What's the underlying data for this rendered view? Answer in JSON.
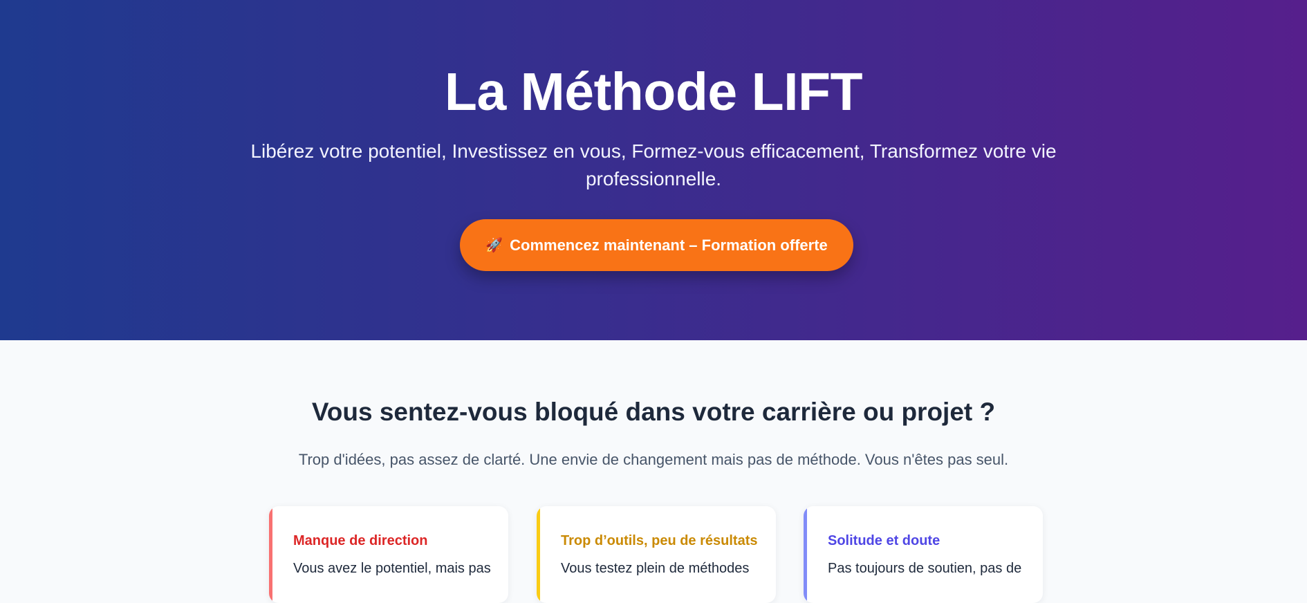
{
  "hero": {
    "title": "La Méthode LIFT",
    "subtitle": "Libérez votre potentiel, Investissez en vous, Formez-vous efficacement, Transformez votre vie professionnelle.",
    "cta": {
      "icon": "rocket-icon",
      "icon_glyph": "🚀",
      "label": "Commencez maintenant – Formation offerte"
    },
    "gradient_colors": [
      "#1f3a8f",
      "#561f8c"
    ],
    "cta_color": "#f97316"
  },
  "problem_section": {
    "title": "Vous sentez-vous bloqué dans votre carrière ou projet ?",
    "lead": "Trop d'idées, pas assez de clarté. Une envie de changement mais pas de méthode. Vous n'êtes pas seul.",
    "cards": [
      {
        "title": "Manque de direction",
        "text": "Vous avez le potentiel, mais pas",
        "accent_color": "#f87171",
        "title_color": "#dc2626"
      },
      {
        "title": "Trop d’outils, peu de résultats",
        "text": "Vous testez plein de méthodes",
        "accent_color": "#facc15",
        "title_color": "#ca8a04"
      },
      {
        "title": "Solitude et doute",
        "text": "Pas toujours de soutien, pas de",
        "accent_color": "#818cf8",
        "title_color": "#4f46e5"
      }
    ]
  }
}
